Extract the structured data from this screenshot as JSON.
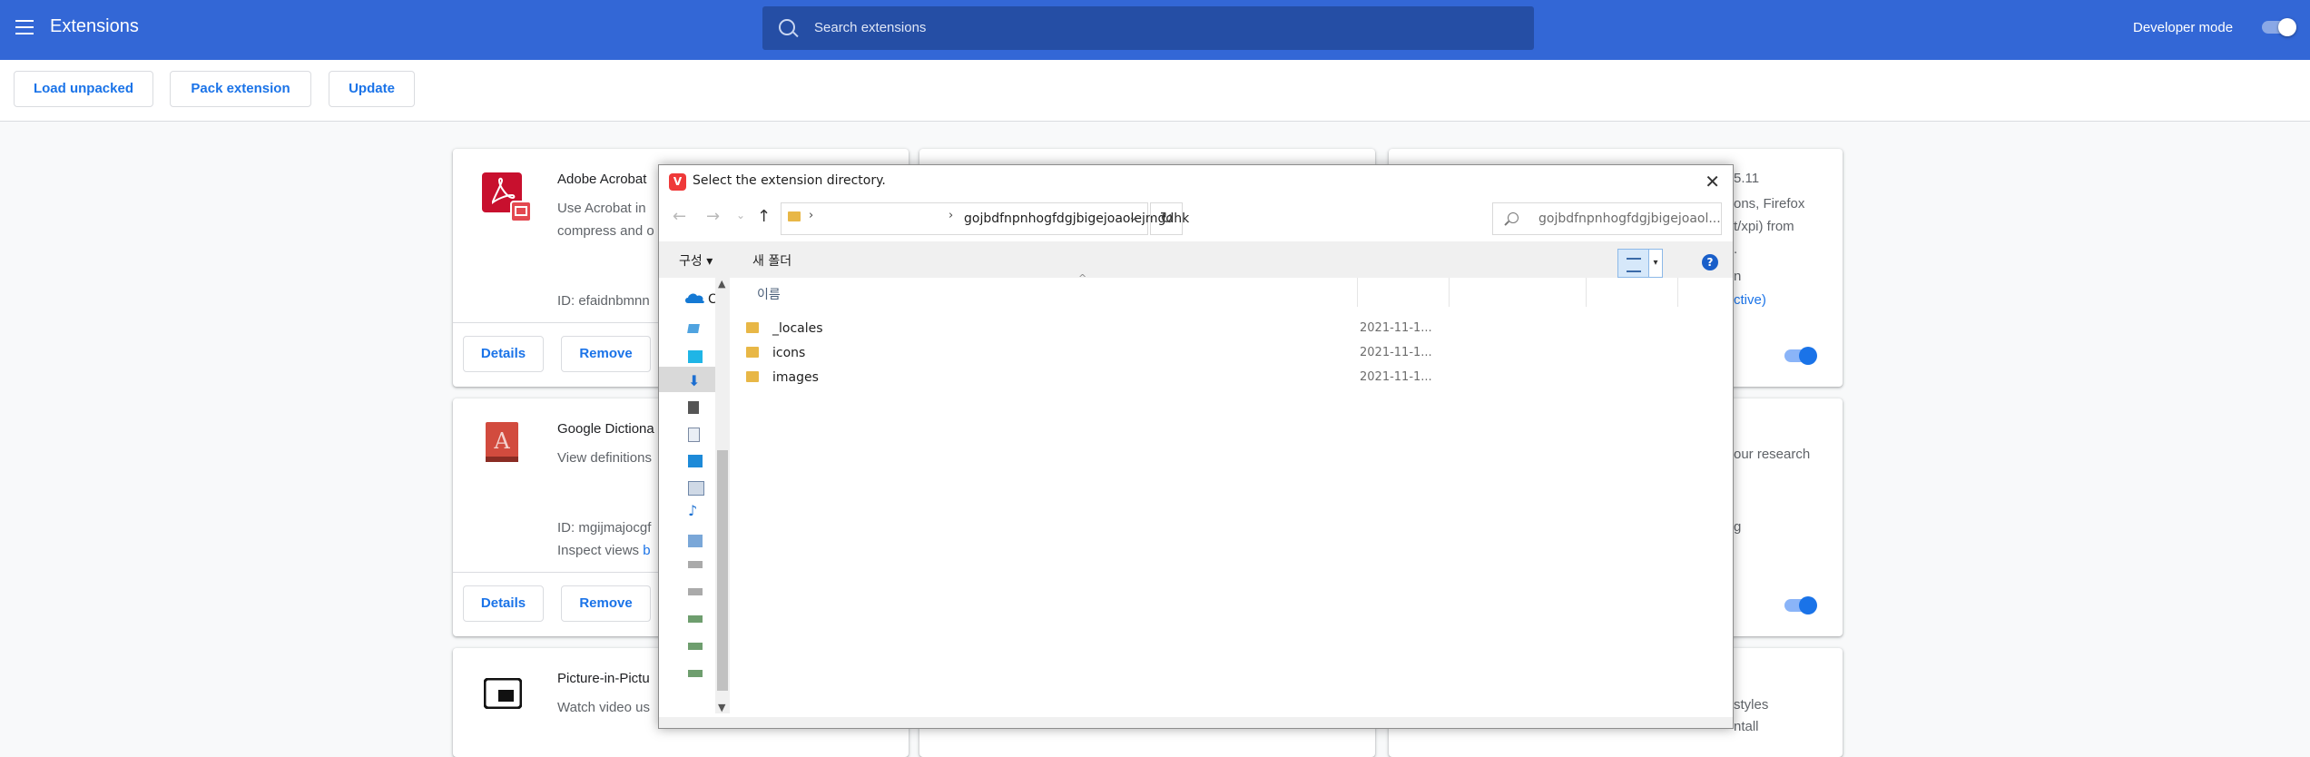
{
  "header": {
    "title": "Extensions",
    "search_placeholder": "Search extensions",
    "developer_mode_label": "Developer mode"
  },
  "toolbar": {
    "load_unpacked": "Load unpacked",
    "pack_extension": "Pack extension",
    "update": "Update"
  },
  "cards": [
    {
      "name": "Adobe Acrobat",
      "desc_line1": "Use Acrobat in",
      "desc_line2": "compress and o",
      "id": "ID: efaidnbmnn",
      "details": "Details",
      "remove": "Remove",
      "enabled": true
    },
    {
      "name": "Google Dictiona",
      "desc_line1": "View definitions",
      "id": "ID: mgijmajocgf",
      "inspect_prefix": "Inspect views",
      "inspect_link": "b",
      "details": "Details",
      "remove": "Remove",
      "enabled": true
    },
    {
      "name": "Picture-in-Pictu",
      "desc_line1": "Watch video us"
    }
  ],
  "right_fragments": {
    "c1_a": "5.11",
    "c1_b": "ons, Firefox",
    "c1_c": "t/xpi) from",
    "c1_d": ".",
    "c1_e": "n",
    "c1_f": "ctive)",
    "c2_a": "our research",
    "c2_b": "g",
    "c3_a": "styles",
    "c3_b": "ntall"
  },
  "dialog": {
    "title": "Select the extension directory.",
    "close": "✕",
    "address_path": "gojbdfnpnhogfdgjbigejoaolejmgdhk",
    "search_value": "gojbdfnpnhogfdgjbigejoaol...",
    "organize": "구성 ▾",
    "new_folder": "새 폴더",
    "help": "?",
    "column_name": "이름",
    "nav_partial": "C",
    "files": [
      {
        "name": "_locales",
        "date": "2021-11-1..."
      },
      {
        "name": "icons",
        "date": "2021-11-1..."
      },
      {
        "name": "images",
        "date": "2021-11-1..."
      }
    ]
  },
  "icons": {
    "menu": "hamburger-icon",
    "search": "search-icon",
    "back": "←",
    "forward": "→",
    "recent": "⌄",
    "up": "↑",
    "refresh": "↻"
  },
  "colors": {
    "header_bg": "#3367d6",
    "accent": "#1a73e8",
    "dialog_icon": "#ef3939"
  }
}
